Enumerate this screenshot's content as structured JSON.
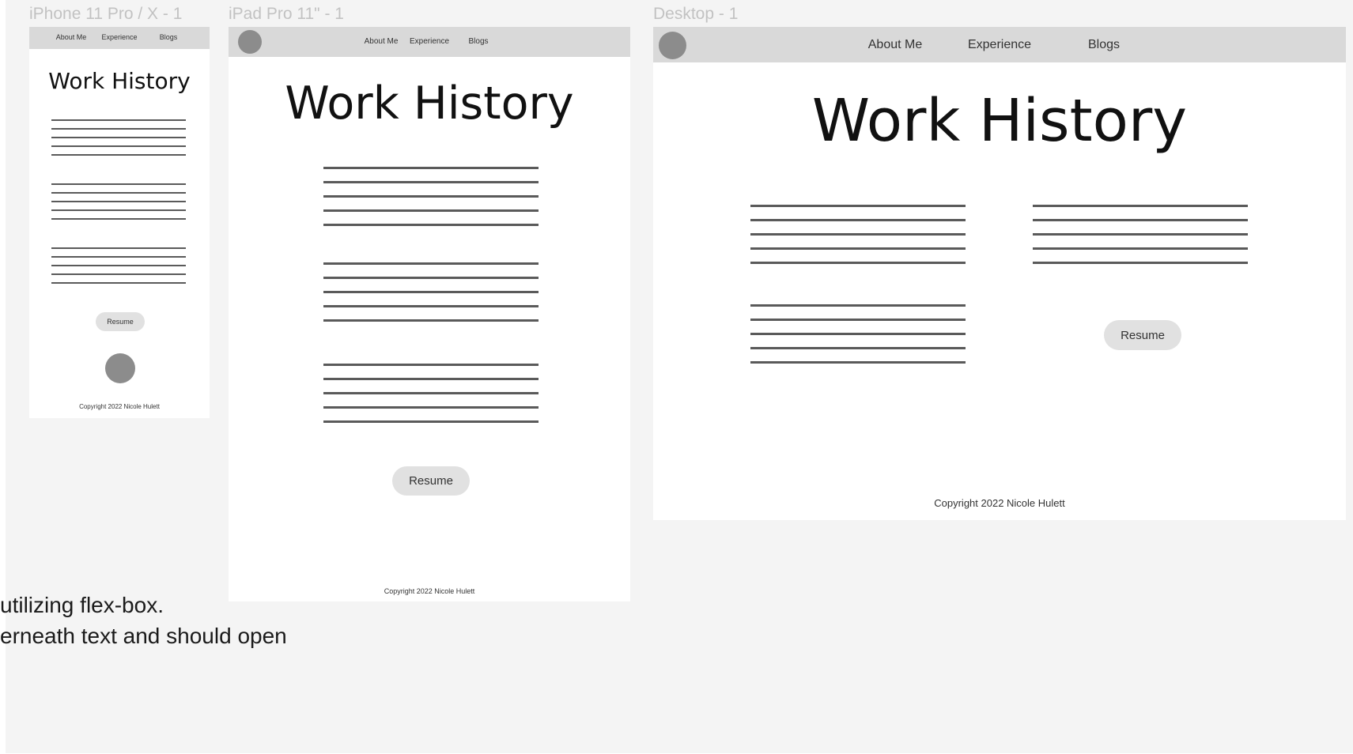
{
  "colors": {
    "canvas": "#f4f4f4",
    "frame": "#ffffff",
    "navbar": "#d9d9d9",
    "avatar": "#8c8c8c",
    "button": "#e1e1e1",
    "frame_label": "#c2c2c2"
  },
  "frames": {
    "phone": {
      "label": "iPhone 11 Pro / X - 1",
      "nav": [
        "About Me",
        "Experience",
        "Blogs"
      ],
      "title": "Work History",
      "resume": "Resume",
      "footer": "Copyright 2022 Nicole Hulett"
    },
    "tablet": {
      "label": "iPad Pro 11\" - 1",
      "nav": [
        "About Me",
        "Experience",
        "Blogs"
      ],
      "title": "Work History",
      "resume": "Resume",
      "footer": "Copyright 2022 Nicole Hulett"
    },
    "desktop": {
      "label": "Desktop - 1",
      "nav": [
        "About Me",
        "Experience",
        "Blogs"
      ],
      "title": "Work History",
      "resume": "Resume",
      "footer": "Copyright 2022 Nicole Hulett"
    }
  },
  "notes": [
    "utilizing flex-box.",
    "erneath text and should open"
  ]
}
